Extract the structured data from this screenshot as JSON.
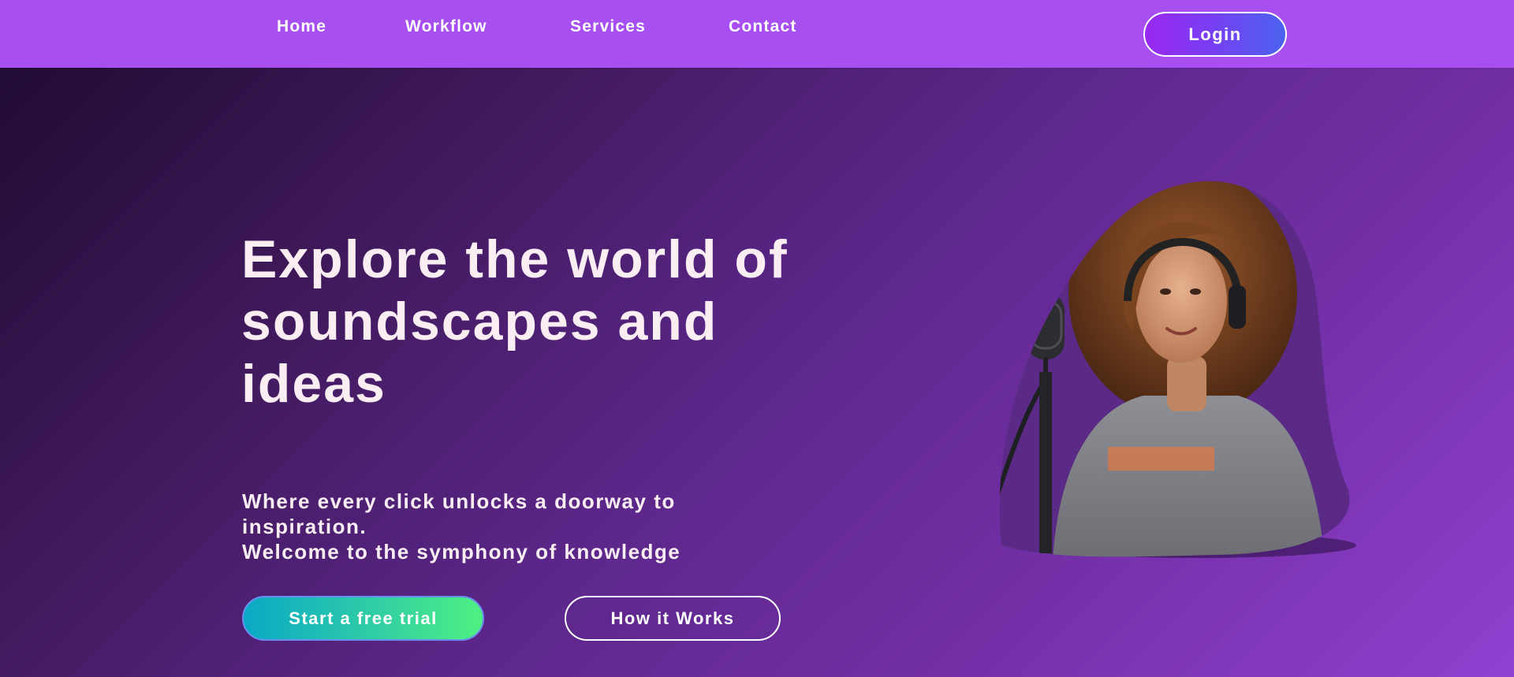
{
  "nav": {
    "links": [
      "Home",
      "Workflow",
      "Services",
      "Contact"
    ],
    "login_label": "Login"
  },
  "hero": {
    "title": "Explore the world of soundscapes and ideas",
    "subtitle_line1": "Where every click unlocks a doorway to inspiration.",
    "subtitle_line2": "Welcome to the symphony of knowledge",
    "primary_button": "Start a free trial",
    "secondary_button": "How it Works",
    "illustration": "podcaster-with-microphone"
  },
  "colors": {
    "navbar": "#a74ff0",
    "background_start": "#1c0a2f",
    "background_end": "#8f41d0",
    "login_gradient": [
      "#9b28f0",
      "#4b63f0"
    ],
    "trial_gradient": [
      "#0aa9c5",
      "#4ff082"
    ],
    "text": "#fbeef3"
  }
}
